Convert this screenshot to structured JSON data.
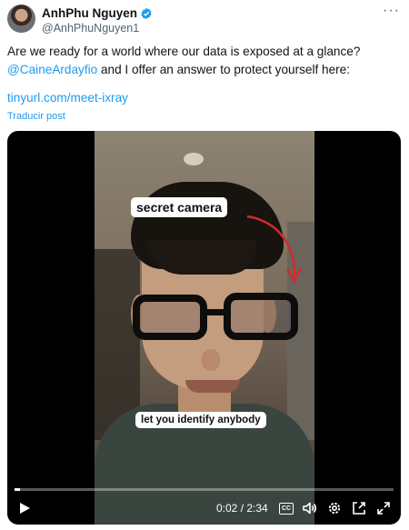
{
  "author": {
    "display_name": "AnhPhu Nguyen",
    "handle": "@AnhPhuNguyen1",
    "verified_color": "#1d9bf0"
  },
  "tweet": {
    "text_line1": "Are we ready for a world where our data is exposed at a glance?",
    "mention": "@CaineArdayfio",
    "text_line2_rest": " and I offer an answer to protect yourself here:",
    "link": "tinyurl.com/meet-ixray",
    "translate_label": "Traducir post"
  },
  "video": {
    "caption_top": "secret camera",
    "caption_bottom": "let you identify anybody",
    "progress_fraction": 0.014,
    "time": "0:02 / 2:34",
    "cc_label": "CC"
  },
  "icons": [
    "verified-icon",
    "more-icon",
    "play-icon",
    "cc-icon",
    "volume-icon",
    "settings-icon",
    "popout-icon",
    "fullscreen-icon"
  ],
  "colors": {
    "link": "#1d9bf0",
    "text": "#0f1419",
    "muted": "#536471"
  }
}
